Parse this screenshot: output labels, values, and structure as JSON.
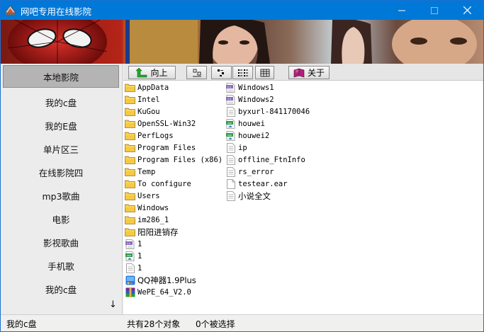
{
  "window": {
    "title": "网吧专用在线影院"
  },
  "toolbar": {
    "up_label": "向上",
    "about_label": "关于"
  },
  "sidebar": {
    "items": [
      {
        "label": "本地影院",
        "active": true
      },
      {
        "label": "我的c盘"
      },
      {
        "label": "我的E盘"
      },
      {
        "label": "单片区三"
      },
      {
        "label": "在线影院四"
      },
      {
        "label": "mp3歌曲"
      },
      {
        "label": "电影"
      },
      {
        "label": "影视歌曲"
      },
      {
        "label": "手机歌"
      },
      {
        "label": "我的c盘"
      }
    ],
    "more_indicator": "↓"
  },
  "files": {
    "col1": [
      {
        "name": "AppData",
        "icon": "folder-icon"
      },
      {
        "name": "Intel",
        "icon": "folder-icon"
      },
      {
        "name": "KuGou",
        "icon": "folder-icon"
      },
      {
        "name": "OpenSSL-Win32",
        "icon": "folder-icon"
      },
      {
        "name": "PerfLogs",
        "icon": "folder-icon"
      },
      {
        "name": "Program Files",
        "icon": "folder-icon"
      },
      {
        "name": "Program Files (x86)",
        "icon": "folder-icon"
      },
      {
        "name": "Temp",
        "icon": "folder-icon"
      },
      {
        "name": "To configure",
        "icon": "folder-icon"
      },
      {
        "name": "Users",
        "icon": "folder-icon"
      },
      {
        "name": "Windows",
        "icon": "folder-icon"
      },
      {
        "name": "im286_1",
        "icon": "folder-icon"
      },
      {
        "name": "阳阳进销存",
        "icon": "folder-icon"
      },
      {
        "name": "1",
        "icon": "php-file-icon"
      },
      {
        "name": "1",
        "icon": "jpg-file-icon"
      },
      {
        "name": "1",
        "icon": "text-file-icon"
      },
      {
        "name": "QQ神器1.9Plus",
        "icon": "app-icon"
      },
      {
        "name": "WePE_64_V2.0",
        "icon": "winrar-icon"
      }
    ],
    "col2": [
      {
        "name": "Windows1",
        "icon": "php-file-icon"
      },
      {
        "name": "Windows2",
        "icon": "php-file-icon"
      },
      {
        "name": "byxurl-841170046",
        "icon": "text-file-icon"
      },
      {
        "name": "houwei",
        "icon": "jpg-file-icon"
      },
      {
        "name": "houwei2",
        "icon": "jpg-file-icon"
      },
      {
        "name": "ip",
        "icon": "text-file-icon"
      },
      {
        "name": "offline_FtnInfo",
        "icon": "text-file-icon"
      },
      {
        "name": "rs_error",
        "icon": "text-file-icon"
      },
      {
        "name": "testear.ear",
        "icon": "blank-file-icon"
      },
      {
        "name": "小说全文",
        "icon": "text-file-icon"
      }
    ]
  },
  "status": {
    "location": "我的c盘",
    "object_count": "共有28个对象",
    "selected": "0个被选择"
  },
  "colors": {
    "titlebar": "#0078d7",
    "sidebar_active": "#b4b4b4",
    "folder": "#f5c942"
  }
}
